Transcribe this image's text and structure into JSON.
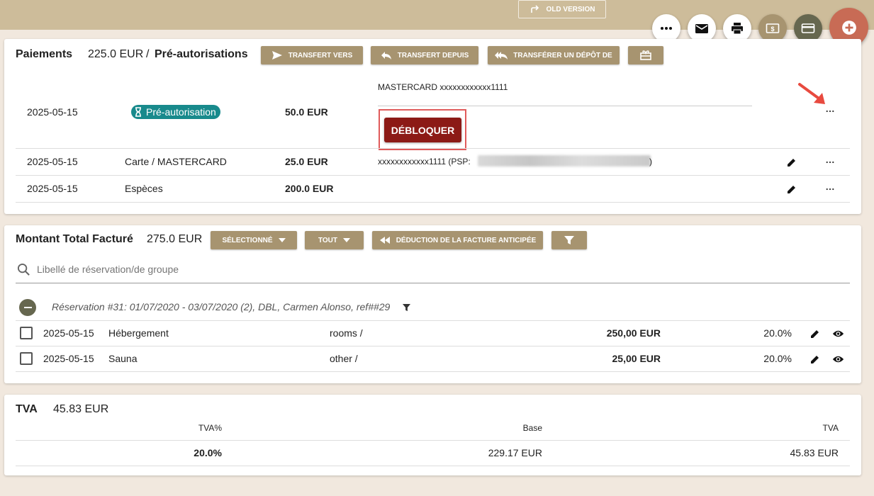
{
  "topbar": {
    "old_version_label": "OLD VERSION"
  },
  "fabs": {
    "more": "more-icon",
    "email": "envelope-icon",
    "print": "printer-icon",
    "invoice": "dollar-icon",
    "card": "credit-card-icon",
    "add": "plus-icon",
    "colors": {
      "brown": "#a79470",
      "green": "#66674f",
      "orange": "#c86b55"
    }
  },
  "payments": {
    "title": "Paiements",
    "amount": "225.0 EUR",
    "sep": "/",
    "preauth_title": "Pré-autorisations",
    "buttons": {
      "transfer_to": "TRANSFERT VERS",
      "transfer_from": "TRANSFERT DEPUIS",
      "transfer_deposit": "TRANSFÉRER UN DÉPÔT DE"
    },
    "rows": [
      {
        "date": "2025-05-15",
        "type": "Pré-autorisation",
        "amount": "50.0 EUR",
        "card": "MASTERCARD xxxxxxxxxxxx1111",
        "action": "DÉBLOQUER"
      },
      {
        "date": "2025-05-15",
        "type": "Carte / MASTERCARD",
        "amount": "25.0 EUR",
        "card_prefix": "xxxxxxxxxxxx1111 (PSP:",
        "card_suffix": ")"
      },
      {
        "date": "2025-05-15",
        "type": "Espèces",
        "amount": "200.0 EUR"
      }
    ],
    "accent": "#188a8c",
    "danger": "#8c1a16"
  },
  "billing": {
    "title": "Montant Total Facturé",
    "amount": "275.0 EUR",
    "buttons": {
      "selected": "SÉLECTIONNÉ",
      "all": "TOUT",
      "deduction": "DÉDUCTION DE LA FACTURE ANTICIPÉE"
    },
    "search_placeholder": "Libellé de réservation/de groupe",
    "reservation": "Réservation #31: 01/07/2020 - 03/07/2020 (2), DBL, Carmen Alonso, ref##29",
    "items": [
      {
        "date": "2025-05-15",
        "name": "Hébergement",
        "category": "rooms /",
        "amount": "250,00 EUR",
        "tax": "20.0%"
      },
      {
        "date": "2025-05-15",
        "name": "Sauna",
        "category": "other /",
        "amount": "25,00 EUR",
        "tax": "20.0%"
      }
    ]
  },
  "tva": {
    "title": "TVA",
    "amount": "45.83 EUR",
    "headers": {
      "rate": "TVA%",
      "base": "Base",
      "tva": "TVA"
    },
    "row": {
      "rate": "20.0%",
      "base": "229.17 EUR",
      "tva": "45.83 EUR"
    }
  }
}
